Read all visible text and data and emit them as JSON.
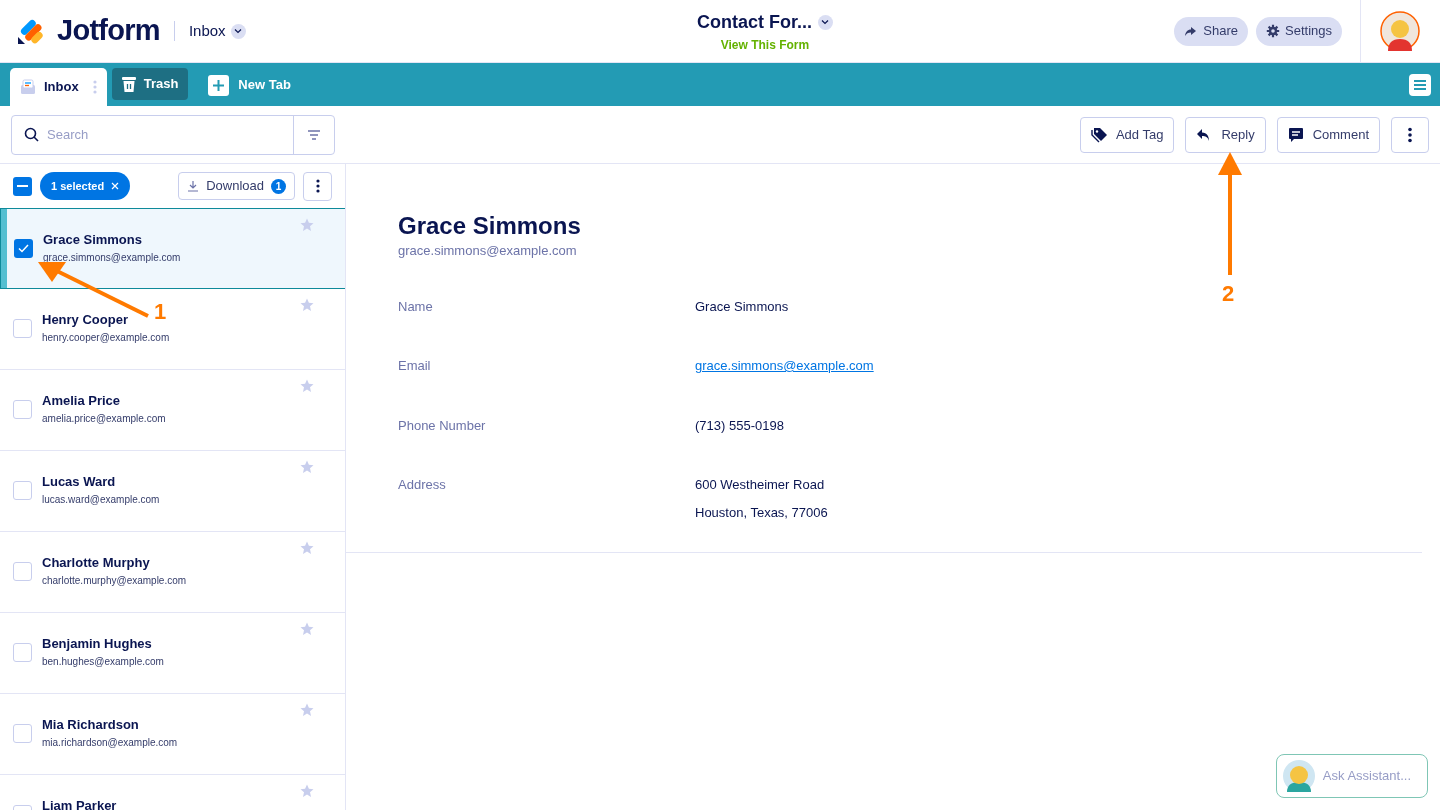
{
  "header": {
    "brand": "Jotform",
    "section": "Inbox",
    "form_title": "Contact For...",
    "form_link": "View This Form",
    "buttons": [
      "Share",
      "Settings"
    ]
  },
  "tabs": [
    {
      "label": "Inbox",
      "selected": true,
      "kind": "inbox"
    },
    {
      "label": "Trash",
      "selected": false,
      "kind": "trash"
    },
    {
      "label": "New Tab",
      "selected": false,
      "kind": "new"
    }
  ],
  "search": {
    "placeholder": "Search"
  },
  "actions": [
    "Add Tag",
    "Reply",
    "Comment"
  ],
  "selection": {
    "indeterminate": true,
    "label": "1 selected",
    "download": "Download",
    "download_count": "1"
  },
  "submissions": [
    {
      "name": "Grace Simmons",
      "email": "grace.simmons@example.com",
      "checked": true,
      "selected": true
    },
    {
      "name": "Henry Cooper",
      "email": "henry.cooper@example.com",
      "checked": false,
      "selected": false
    },
    {
      "name": "Amelia Price",
      "email": "amelia.price@example.com",
      "checked": false,
      "selected": false
    },
    {
      "name": "Lucas Ward",
      "email": "lucas.ward@example.com",
      "checked": false,
      "selected": false
    },
    {
      "name": "Charlotte Murphy",
      "email": "charlotte.murphy@example.com",
      "checked": false,
      "selected": false
    },
    {
      "name": "Benjamin Hughes",
      "email": "ben.hughes@example.com",
      "checked": false,
      "selected": false
    },
    {
      "name": "Mia Richardson",
      "email": "mia.richardson@example.com",
      "checked": false,
      "selected": false
    },
    {
      "name": "Liam Parker",
      "checked": false,
      "selected": false
    }
  ],
  "detail": {
    "name": "Grace Simmons",
    "email": "grace.simmons@example.com",
    "fields": [
      {
        "label": "Name",
        "value": [
          "Grace Simmons"
        ],
        "kind": "text"
      },
      {
        "label": "Email",
        "value": [
          "grace.simmons@example.com"
        ],
        "kind": "link"
      },
      {
        "label": "Phone Number",
        "value": [
          "(713) 555-0198"
        ],
        "kind": "text"
      },
      {
        "label": "Address",
        "value": [
          "600 Westheimer Road",
          "Houston, Texas, 77006"
        ],
        "kind": "text"
      }
    ]
  },
  "assistant": {
    "label": "Ask Assistant..."
  },
  "annotations": [
    {
      "label": "1"
    },
    {
      "label": "2"
    }
  ]
}
